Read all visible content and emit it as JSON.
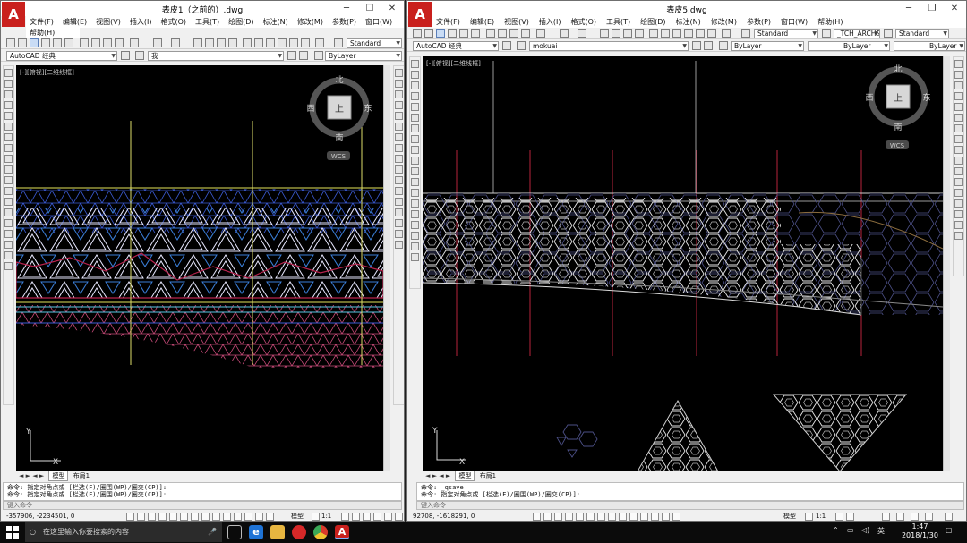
{
  "colors": {
    "accent": "#c9201d",
    "viewport_bg": "#000000",
    "taskbar_bg": "#0b0b0b"
  },
  "left_window": {
    "title": "表皮1（之前的）.dwg",
    "menu": [
      "文件(F)",
      "编辑(E)",
      "视图(V)",
      "插入(I)",
      "格式(O)",
      "工具(T)",
      "绘图(D)",
      "标注(N)",
      "修改(M)",
      "参数(P)",
      "窗口(W)"
    ],
    "menu_row2": "帮助(H)",
    "text_style": "Standard",
    "workspace": "AutoCAD 经典",
    "layer": "我",
    "linetype": "ByLayer",
    "view_label": "[-][俯视][二维线框]",
    "viewcube": {
      "north": "北",
      "south": "南",
      "east": "东",
      "west": "西",
      "top": "上",
      "wcs": "WCS"
    },
    "ucs": {
      "x": "X",
      "y": "Y"
    },
    "tabs": [
      "模型",
      "布局1"
    ],
    "command_lines": [
      "命令: 指定对角点或 [栏选(F)/圈围(WP)/圈交(CP)]:",
      "命令: 指定对角点或 [栏选(F)/圈围(WP)/圈交(CP)]:"
    ],
    "command_placeholder": "键入命令",
    "coords": "-357906, -2234501, 0",
    "model_label": "模型",
    "scale": "1:1"
  },
  "right_window": {
    "title": "表皮5.dwg",
    "menu": [
      "文件(F)",
      "编辑(E)",
      "视图(V)",
      "插入(I)",
      "格式(O)",
      "工具(T)",
      "绘图(D)",
      "标注(N)",
      "修改(M)",
      "参数(P)",
      "窗口(W)",
      "帮助(H)"
    ],
    "text_style": "Standard",
    "dim_style": "_TCH_ARCH&",
    "table_style": "Standard",
    "workspace": "AutoCAD 经典",
    "layer": "mokuai",
    "color": "ByLayer",
    "linetype": "ByLayer",
    "lineweight": "ByLayer",
    "view_label": "[-][俯视][二维线框]",
    "viewcube": {
      "north": "北",
      "south": "南",
      "east": "东",
      "west": "西",
      "top": "上",
      "wcs": "WCS"
    },
    "ucs": {
      "x": "X",
      "y": "Y"
    },
    "tabs": [
      "模型",
      "布局1"
    ],
    "command_lines": [
      "命令: _qsave",
      "命令: 指定对角点或 [栏选(F)/圈围(WP)/圈交(CP)]:"
    ],
    "command_placeholder": "键入命令",
    "coords": "92708, -1618291, 0",
    "model_label": "模型",
    "scale": "1:1"
  },
  "taskbar": {
    "search_placeholder": "在这里输入你要搜索的内容",
    "ime": "英",
    "time": "1:47",
    "date": "2018/1/30"
  }
}
